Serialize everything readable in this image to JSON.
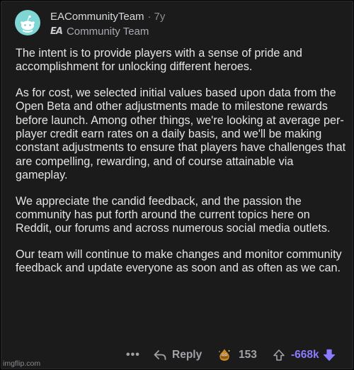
{
  "comment": {
    "username": "EACommunityTeam",
    "separator": "·",
    "age": "7y",
    "flair_logo_text": "EA",
    "flair": "Community Team",
    "paragraphs": [
      "The intent is to provide players with a sense of pride and accomplishment for unlocking different heroes.",
      "As for cost, we selected initial values based upon data from the Open Beta and other adjustments made to milestone rewards before launch.  Among other things, we're looking at average per-player credit earn rates on a daily basis, and we'll be making constant adjustments to ensure that players have challenges that are compelling, rewarding, and of course attainable via gameplay.",
      "We appreciate the candid feedback, and the passion the community has put forth around the current topics here on Reddit, our forums and across numerous social media outlets.",
      "Our team will continue to make changes and monitor community feedback and update everyone as soon and as often as we can."
    ]
  },
  "actions": {
    "more_label": "•••",
    "reply_label": "Reply",
    "award_count": "153",
    "vote_score": "-668k"
  },
  "colors": {
    "background": "#1b1b1c",
    "text": "#e4e4e6",
    "muted": "#a0a2a6",
    "downvote": "#8a7cff",
    "avatar": "#7fd6d4"
  },
  "watermark": "imgflip.com"
}
